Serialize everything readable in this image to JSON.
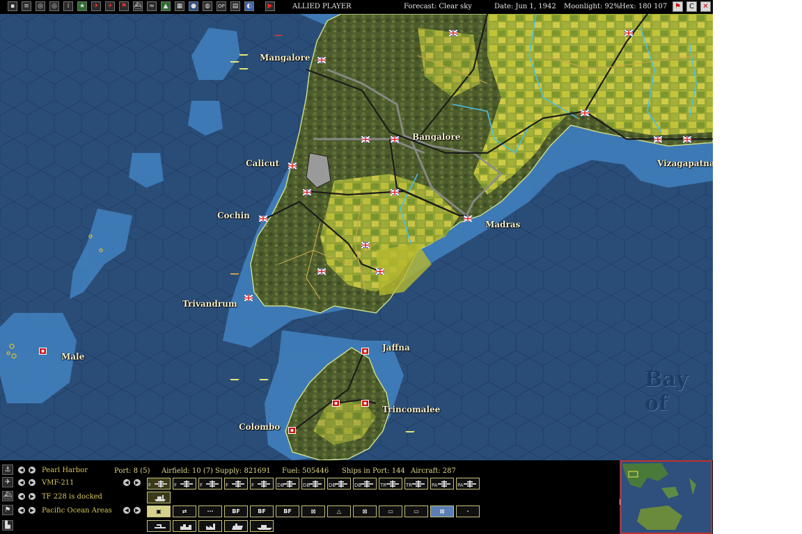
{
  "topbar": {
    "player": "ALLIED PLAYER",
    "forecast": "Forecast: Clear sky",
    "date": "Date:  Jun 1, 1942",
    "moonlight": "Moonlight: 92%",
    "hex": "Hex: 180 107",
    "op_label": "OP",
    "end_turn_icon": "play-icon"
  },
  "map": {
    "cities": {
      "mangalore": "Mangalore",
      "bangalore": "Bangalore",
      "calicut": "Calicut",
      "cochin": "Cochin",
      "madras": "Madras",
      "vizagapatnam": "Vizagapatnam",
      "trivandrum": "Trivandrum",
      "male": "Male",
      "jaffna": "Jaffna",
      "trincomalee": "Trincomalee",
      "colombo": "Colombo"
    },
    "sea_label": "Bay of",
    "colors": {
      "ocean": "#2a4d78",
      "shallow": "#3f79b5",
      "land": "#6b7a3a",
      "field": "#c2c23a"
    }
  },
  "panel": {
    "row1": {
      "name": "Pearl Harbor",
      "port": "Port: 8 (5)",
      "airfield": "Airfield: 10 (7)",
      "supply": "Supply: 821691",
      "fuel": "Fuel: 505446",
      "ships": "Ships in Port: 144",
      "aircraft": "Aircraft: 287"
    },
    "row2": {
      "name": "VMF-211"
    },
    "row3": {
      "name": "TF 228 is docked"
    },
    "row4": {
      "name": "Pacific Ocean Areas"
    },
    "air_buttons": [
      "F",
      "F",
      "F",
      "F",
      "F",
      "DB",
      "DB",
      "DB",
      "DB",
      "TR",
      "TR",
      "PA",
      "PA"
    ],
    "filter_buttons": [
      "",
      "",
      "",
      "BF",
      "BF",
      "BF",
      "",
      "",
      "",
      "",
      "",
      "",
      ""
    ]
  }
}
